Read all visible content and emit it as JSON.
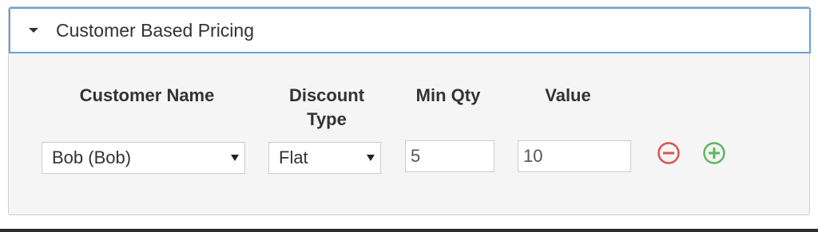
{
  "panel": {
    "title": "Customer Based Pricing"
  },
  "table": {
    "headers": {
      "customer_name": "Customer Name",
      "discount_type_line1": "Discount",
      "discount_type_line2": "Type",
      "min_qty": "Min Qty",
      "value": "Value"
    },
    "rows": [
      {
        "customer": "Bob (Bob)",
        "discount_type": "Flat",
        "min_qty": "5",
        "value": "10"
      }
    ]
  },
  "icons": {
    "remove": "minus-circle-icon",
    "add": "plus-circle-icon",
    "toggle": "caret-down-icon"
  },
  "colors": {
    "remove": "#d9534f",
    "add": "#5cb85c",
    "header_border": "#6aa0d8"
  }
}
